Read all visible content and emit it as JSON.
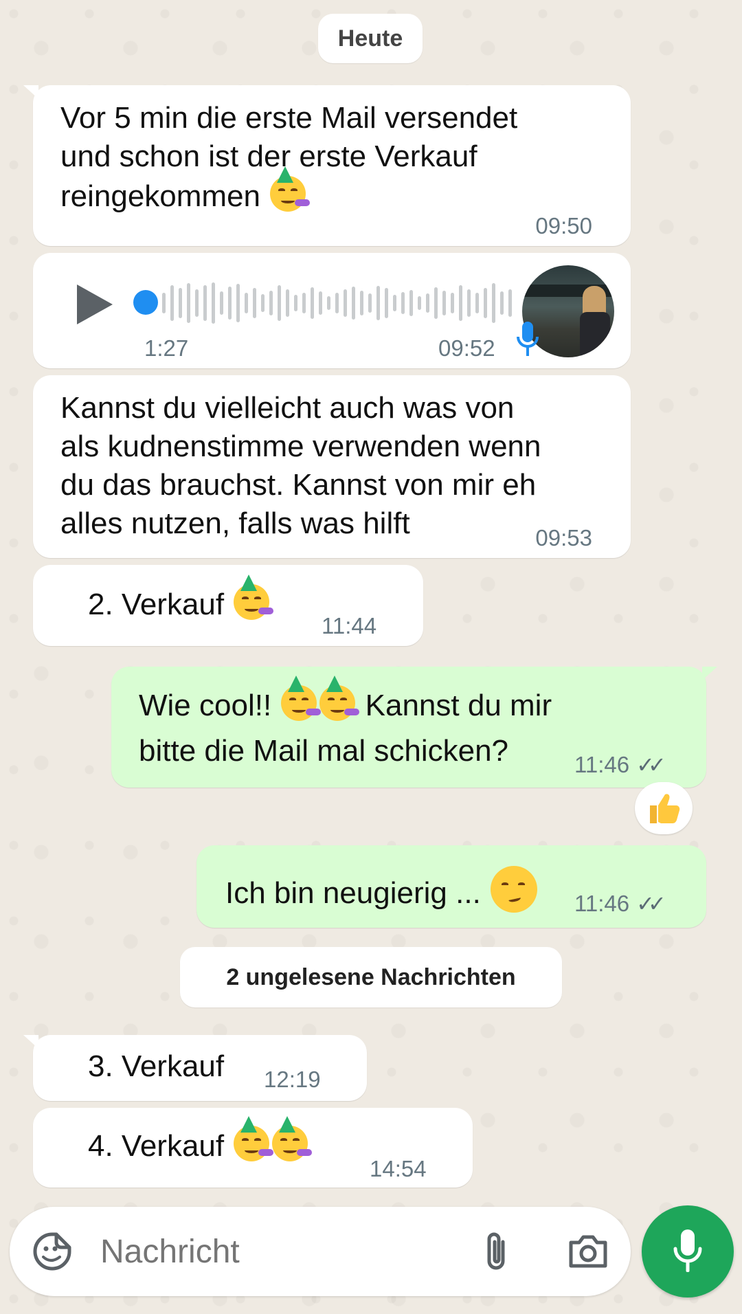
{
  "date_separator": "Heute",
  "messages": [
    {
      "text": "Vor 5 min die erste Mail versendet",
      "line2": "und schon ist der erste Verkauf",
      "line3": "reingekommen",
      "time": "09:50"
    },
    {
      "voice_duration": "1:27",
      "time": "09:52"
    },
    {
      "line1": "Kannst du vielleicht auch was von",
      "line2": "als kudnenstimme verwenden wenn",
      "line3": "du das brauchst. Kannst von mir eh",
      "line4": "alles nutzen, falls was hilft",
      "time": "09:53"
    },
    {
      "text": "2. Verkauf",
      "time": "11:44"
    },
    {
      "text_a": "Wie cool!!",
      "text_b": "Kannst du mir",
      "line2": "bitte die Mail mal schicken?",
      "time": "11:46",
      "reaction": "thumbs-up"
    },
    {
      "text": "Ich bin neugierig ...",
      "time": "11:46"
    }
  ],
  "unread_separator": "2 ungelesene Nachrichten",
  "unread_messages": [
    {
      "text": "3. Verkauf",
      "time": "12:19"
    },
    {
      "text": "4. Verkauf",
      "time": "14:54"
    }
  ],
  "composer": {
    "placeholder": "Nachricht"
  },
  "colors": {
    "background": "#efeae2",
    "incoming_bubble": "#ffffff",
    "outgoing_bubble": "#d9fdd3",
    "mic_button": "#1ea65a",
    "voice_progress_dot": "#1f8ef1",
    "read_ticks": "#5a6b75"
  },
  "icons": [
    "play-icon",
    "mic-badge-icon",
    "sticker-icon",
    "attach-icon",
    "camera-icon",
    "mic-icon",
    "double-check-icon"
  ]
}
